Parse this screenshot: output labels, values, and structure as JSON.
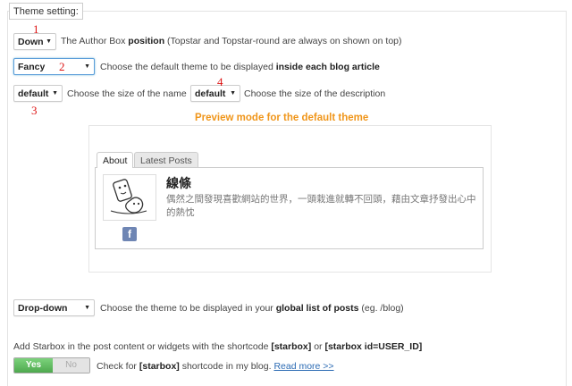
{
  "legend": "Theme setting:",
  "position": {
    "select_value": "Down",
    "label_pre": "The Author Box ",
    "label_bold": "position",
    "label_post": " (Topstar and Topstar-round are always on shown on top)"
  },
  "theme": {
    "select_value": "Fancy",
    "label_pre": "Choose the default theme to be displayed ",
    "label_bold": "inside each blog article"
  },
  "name_size": {
    "select_value": "default",
    "label": "Choose the size of the name"
  },
  "desc_size": {
    "select_value": "default",
    "label": "Choose the size of the description"
  },
  "markers": [
    "1",
    "2",
    "3",
    "4"
  ],
  "preview": {
    "title": "Preview mode for the default theme",
    "tabs": [
      "About",
      "Latest Posts"
    ],
    "author_name": "線條",
    "author_desc": "偶然之間發現喜歡網站的世界，一頭栽進就轉不回頭，藉由文章抒發出心中的熱忱",
    "facebook_glyph": "f"
  },
  "list_theme": {
    "select_value": "Drop-down",
    "label_pre": "Choose the theme to be displayed in your ",
    "label_bold": "global list of posts",
    "label_post": " (eg. /blog)"
  },
  "shortcode": {
    "intro_pre": "Add Starbox in the post content or widgets with the shortcode ",
    "intro_code1": "[starbox]",
    "intro_mid": " or ",
    "intro_code2": "[starbox id=USER_ID]",
    "toggle_yes": "Yes",
    "toggle_no": "No",
    "check_pre": "Check for ",
    "check_bold": "[starbox]",
    "check_post": " shortcode in my blog. ",
    "read_more": "Read more >>"
  },
  "colors": {
    "accent_orange": "#f0961b",
    "marker_red": "#dd1111",
    "toggle_green": "#5cb85c",
    "link_blue": "#2a6ab3"
  }
}
